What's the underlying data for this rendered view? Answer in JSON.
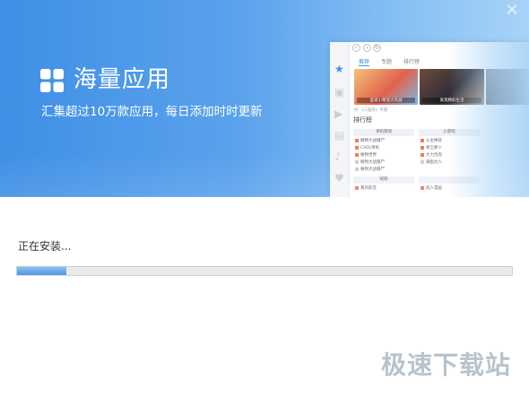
{
  "window": {
    "close_glyph": "✕"
  },
  "banner": {
    "title": "海量应用",
    "subtitle": "汇集超过10万款应用，每日添加时时更新",
    "icon": "grid-four-squares-icon",
    "gradient": [
      "#3f8fe6",
      "#a9d3f7"
    ]
  },
  "preview": {
    "tabs": [
      "推荐",
      "专题",
      "排行榜"
    ],
    "banner_captions": [
      "圣诞小萌宠大作战",
      "发现精彩生活"
    ],
    "section_title": "排行榜",
    "small_caption": "你   《三国杀》专题",
    "lists": [
      {
        "header": "单机游戏",
        "rows": [
          "植物大战僵尸",
          "CSOL单机",
          "植物世界",
          "植物大战僵尸",
          "植物大战僵尸"
        ]
      },
      {
        "header": "小游戏",
        "rows": [
          "公主换装",
          "保卫萝卜",
          "大力泡泡",
          "捕鱼达人"
        ]
      },
      {
        "header": "视频",
        "rows": [
          "暴风影音"
        ]
      },
      {
        "header": "",
        "rows": [
          "成人漫画"
        ]
      }
    ]
  },
  "install": {
    "status": "正在安装...",
    "progress": 0.1,
    "progress_color": "#4a97e2"
  },
  "watermark": {
    "text": "极速下载站"
  }
}
